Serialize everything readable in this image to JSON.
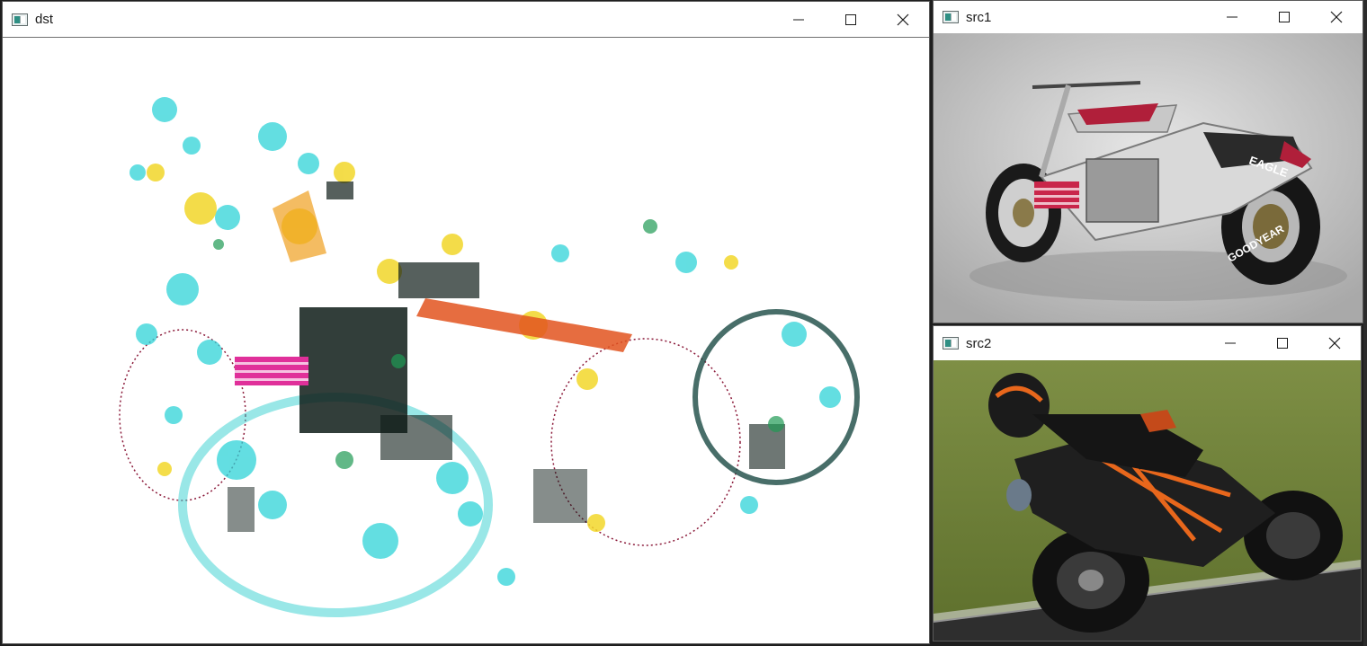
{
  "windows": {
    "dst": {
      "title": "dst"
    },
    "src1": {
      "title": "src1"
    },
    "src2": {
      "title": "src2"
    }
  },
  "controls": {
    "minimize_icon": "minimize-icon",
    "maximize_icon": "maximize-icon",
    "close_icon": "close-icon"
  },
  "src1_image": {
    "tire_text_top": "EAGLE",
    "tire_text_bottom": "GOODYEAR"
  }
}
